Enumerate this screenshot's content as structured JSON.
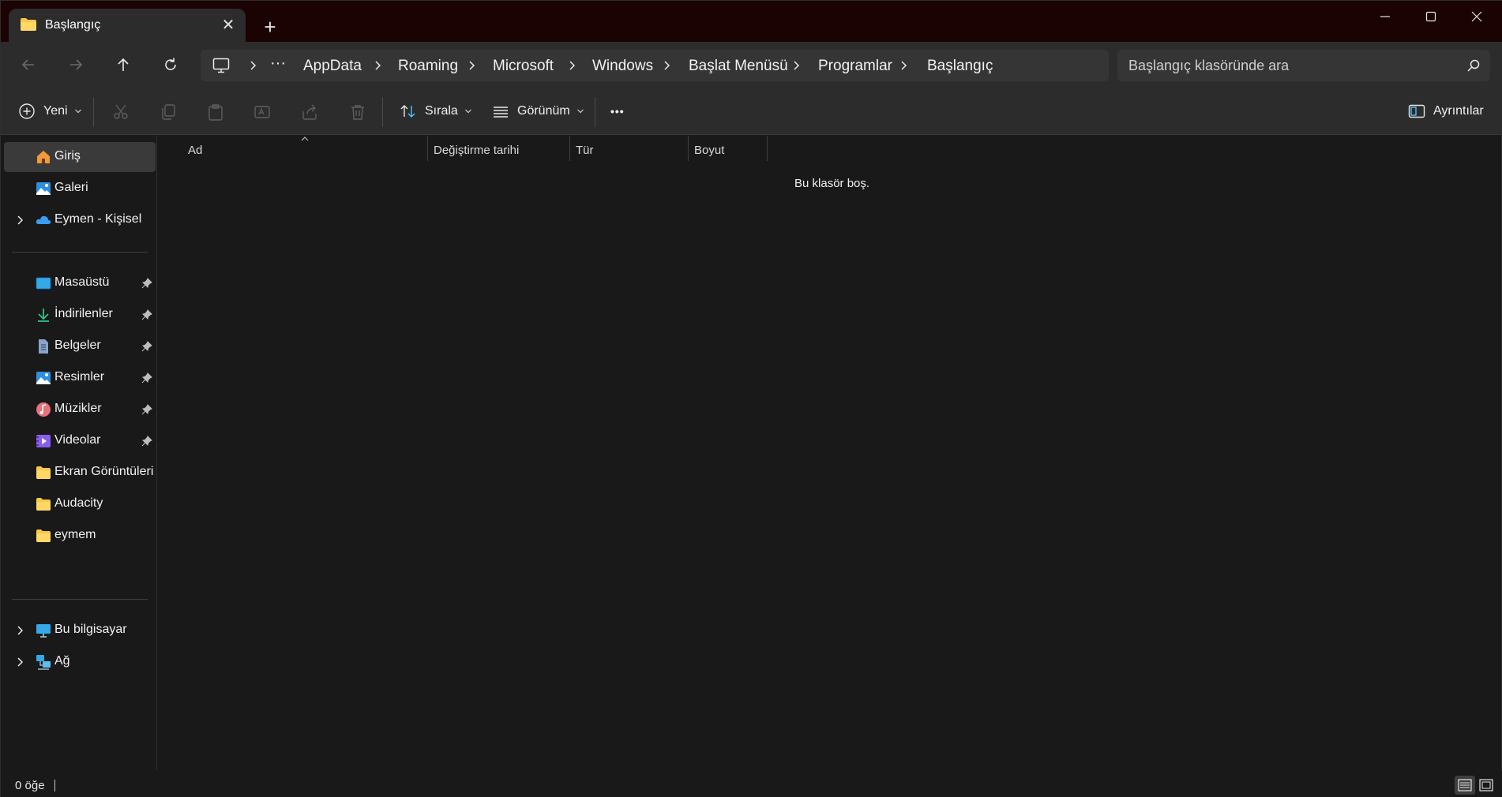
{
  "window": {
    "tab_title": "Başlangıç",
    "new_tab": "+",
    "close_tab": "✕"
  },
  "breadcrumb": {
    "overflow": "···",
    "items": [
      "AppData",
      "Roaming",
      "Microsoft",
      "Windows",
      "Başlat Menüsü",
      "Programlar",
      "Başlangıç"
    ]
  },
  "search": {
    "placeholder": "Başlangıç klasöründe ara"
  },
  "toolbar": {
    "new_label": "Yeni",
    "sort_label": "Sırala",
    "view_label": "Görünüm",
    "more": "•••",
    "details_label": "Ayrıntılar"
  },
  "sidebar": {
    "top": [
      {
        "label": "Giriş",
        "icon": "home-icon"
      },
      {
        "label": "Galeri",
        "icon": "gallery-icon"
      },
      {
        "label": "Eymen - Kişisel",
        "icon": "onedrive-cloud-icon"
      }
    ],
    "quick": [
      {
        "label": "Masaüstü",
        "icon": "desktop-icon",
        "pinned": true
      },
      {
        "label": "İndirilenler",
        "icon": "download-icon",
        "pinned": true
      },
      {
        "label": "Belgeler",
        "icon": "documents-icon",
        "pinned": true
      },
      {
        "label": "Resimler",
        "icon": "pictures-icon",
        "pinned": true
      },
      {
        "label": "Müzikler",
        "icon": "music-icon",
        "pinned": true
      },
      {
        "label": "Videolar",
        "icon": "videos-icon",
        "pinned": true
      },
      {
        "label": "Ekran Görüntüleri",
        "icon": "folder-icon",
        "pinned": false
      },
      {
        "label": "Audacity",
        "icon": "folder-icon",
        "pinned": false
      },
      {
        "label": "eymem",
        "icon": "folder-icon",
        "pinned": false
      }
    ],
    "bottom": [
      {
        "label": "Bu bilgisayar",
        "icon": "this-pc-icon"
      },
      {
        "label": "Ağ",
        "icon": "network-icon"
      }
    ]
  },
  "columns": {
    "name": "Ad",
    "modified": "Değiştirme tarihi",
    "type": "Tür",
    "size": "Boyut"
  },
  "content": {
    "empty_message": "Bu klasör boş."
  },
  "status": {
    "item_count": "0 öğe"
  },
  "colors": {
    "title_bar": "#1c0303",
    "folder": "#f6c94d",
    "accent": "#4cc2ff"
  }
}
